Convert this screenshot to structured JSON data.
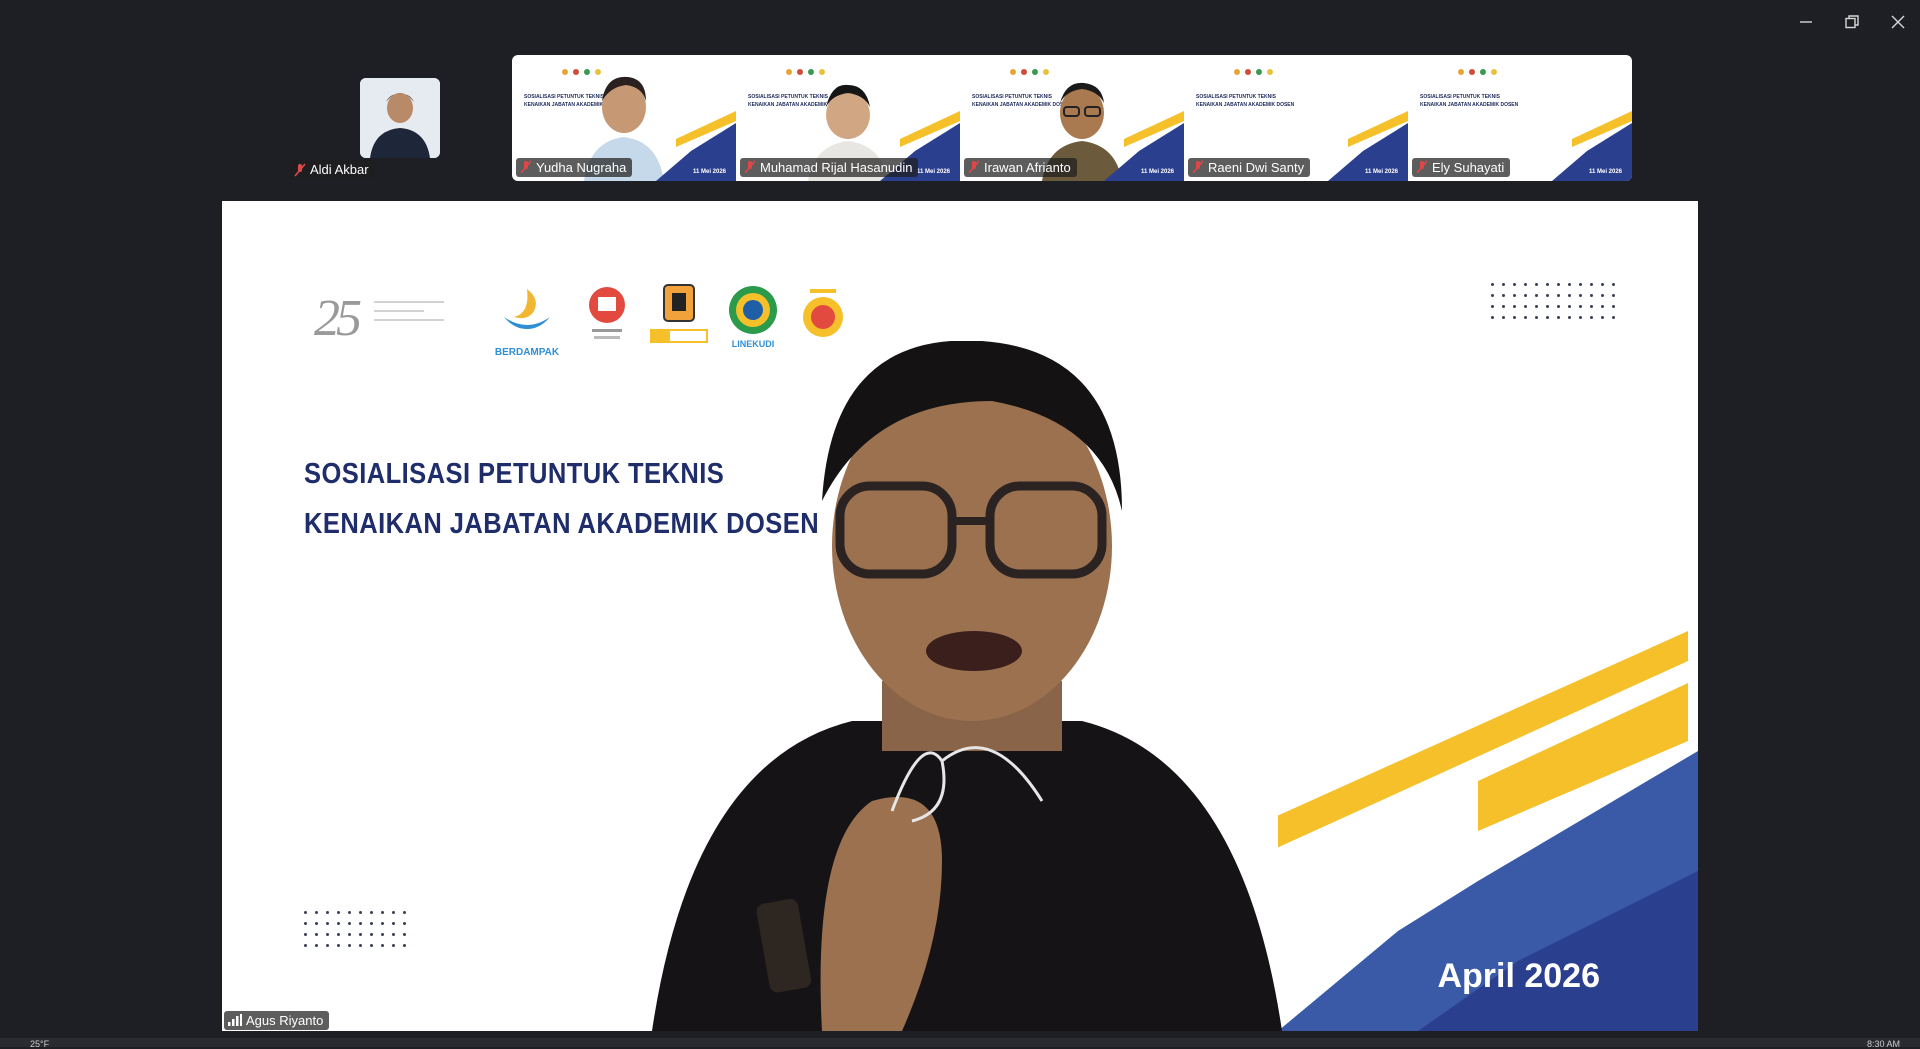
{
  "window": {
    "minimize": "minimize",
    "restore": "restore",
    "close": "close"
  },
  "self": {
    "name": "Aldi Akbar"
  },
  "participants": [
    {
      "name": "Yudha Nugraha",
      "date": "11 Mei 2026"
    },
    {
      "name": "Muhamad Rijal Hasanudin",
      "date": "11 Mei 2026"
    },
    {
      "name": "Irawan Afrianto",
      "date": "11 Mei 2026"
    },
    {
      "name": "Raeni Dwi Santy",
      "date": "11 Mei 2026"
    },
    {
      "name": "Ely Suhayati",
      "date": "11 Mei 2026"
    }
  ],
  "mini_title": [
    "SOSIALISASI PETUNTUK TEKNIS",
    "KENAIKAN JABATAN AKADEMIK DOSEN"
  ],
  "slide": {
    "logo_number": "25",
    "title_line1": "SOSIALISASI PETUNTUK TEKNIS",
    "title_line2": "KENAIKAN JABATAN AKADEMIK DOSEN",
    "date": "April 2026",
    "partner_logo_1_text": "BERDAMPAK",
    "partner_logo_4_text": "LINEKUDI"
  },
  "speaker": {
    "name": "Agus Riyanto"
  },
  "taskbar": {
    "left": "25°F",
    "right": "8:30 AM"
  },
  "colors": {
    "navy": "#1f2d6b",
    "gold": "#f5c02a",
    "blue": "#3a5aa8",
    "background": "#1d1f24"
  }
}
